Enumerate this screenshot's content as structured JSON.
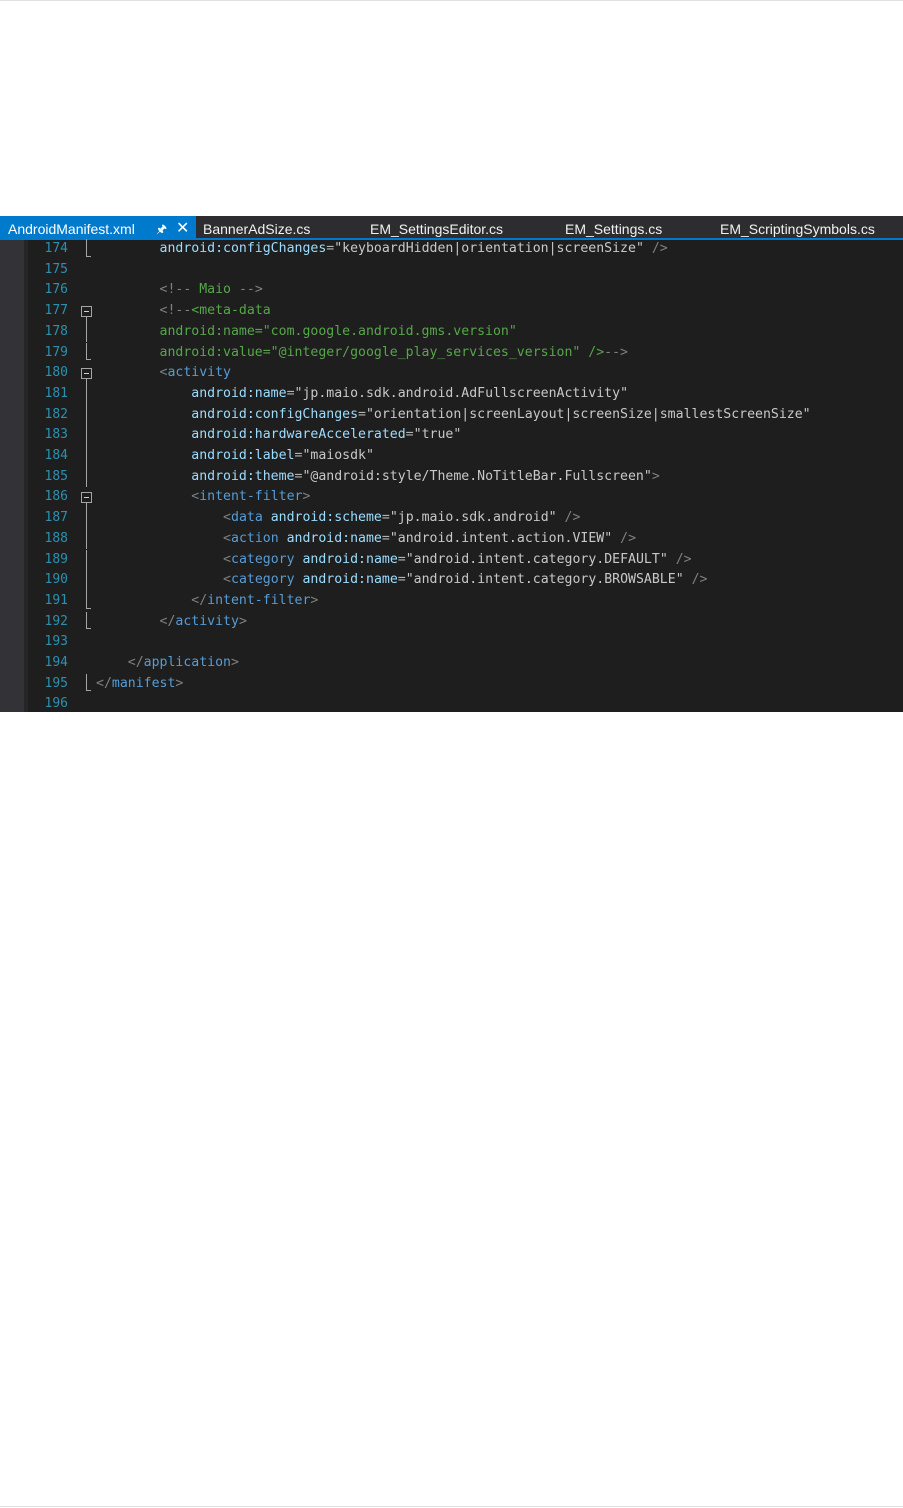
{
  "tabs": [
    {
      "label": "AndroidManifest.xml",
      "active": true,
      "pin_icon": "pin-icon",
      "close_icon": "close-icon"
    },
    {
      "label": "BannerAdSize.cs",
      "active": false
    },
    {
      "label": "EM_SettingsEditor.cs",
      "active": false
    },
    {
      "label": "EM_Settings.cs",
      "active": false
    },
    {
      "label": "EM_ScriptingSymbols.cs",
      "active": false
    }
  ],
  "colors": {
    "accent": "#007acc",
    "editor_bg": "#1e1e1e",
    "line_number": "#2b91af",
    "xml_element": "#569cd6",
    "xml_attribute": "#9cdcfe",
    "comment": "#57a64a",
    "delimiter": "#808080",
    "value": "#c8c8c8"
  },
  "code_lines": [
    {
      "n": "174",
      "fold": "end",
      "tokens": [
        [
          "t-v",
          "        "
        ],
        [
          "t-a",
          "android:configChanges"
        ],
        [
          "t-p",
          "="
        ],
        [
          "t-q",
          "\""
        ],
        [
          "t-v",
          "keyboardHidden|orientation|screenSize"
        ],
        [
          "t-q",
          "\""
        ],
        [
          "t-v",
          " "
        ],
        [
          "t-d",
          "/>"
        ]
      ]
    },
    {
      "n": "175",
      "fold": "",
      "tokens": []
    },
    {
      "n": "176",
      "fold": "",
      "tokens": [
        [
          "t-v",
          "        "
        ],
        [
          "t-d",
          "<!--"
        ],
        [
          "t-c",
          " Maio "
        ],
        [
          "t-d",
          "-->"
        ]
      ]
    },
    {
      "n": "177",
      "fold": "box",
      "tokens": [
        [
          "t-v",
          "        "
        ],
        [
          "t-d",
          "<!--"
        ],
        [
          "t-c",
          "<meta-data"
        ]
      ]
    },
    {
      "n": "178",
      "fold": "line",
      "tokens": [
        [
          "t-v",
          "        "
        ],
        [
          "t-c",
          "android:name=\"com.google.android.gms.version\""
        ]
      ]
    },
    {
      "n": "179",
      "fold": "end",
      "tokens": [
        [
          "t-v",
          "        "
        ],
        [
          "t-c",
          "android:value=\"@integer/google_play_services_version\" />"
        ],
        [
          "t-d",
          "-->"
        ]
      ]
    },
    {
      "n": "180",
      "fold": "box",
      "tokens": [
        [
          "t-v",
          "        "
        ],
        [
          "t-d",
          "<"
        ],
        [
          "t-e",
          "activity"
        ]
      ]
    },
    {
      "n": "181",
      "fold": "line",
      "tokens": [
        [
          "t-v",
          "            "
        ],
        [
          "t-a",
          "android:name"
        ],
        [
          "t-p",
          "="
        ],
        [
          "t-q",
          "\""
        ],
        [
          "t-v",
          "jp.maio.sdk.android.AdFullscreenActivity"
        ],
        [
          "t-q",
          "\""
        ]
      ]
    },
    {
      "n": "182",
      "fold": "line",
      "tokens": [
        [
          "t-v",
          "            "
        ],
        [
          "t-a",
          "android:configChanges"
        ],
        [
          "t-p",
          "="
        ],
        [
          "t-q",
          "\""
        ],
        [
          "t-v",
          "orientation|screenLayout|screenSize|smallestScreenSize"
        ],
        [
          "t-q",
          "\""
        ]
      ]
    },
    {
      "n": "183",
      "fold": "line",
      "tokens": [
        [
          "t-v",
          "            "
        ],
        [
          "t-a",
          "android:hardwareAccelerated"
        ],
        [
          "t-p",
          "="
        ],
        [
          "t-q",
          "\""
        ],
        [
          "t-v",
          "true"
        ],
        [
          "t-q",
          "\""
        ]
      ]
    },
    {
      "n": "184",
      "fold": "line",
      "tokens": [
        [
          "t-v",
          "            "
        ],
        [
          "t-a",
          "android:label"
        ],
        [
          "t-p",
          "="
        ],
        [
          "t-q",
          "\""
        ],
        [
          "t-v",
          "maiosdk"
        ],
        [
          "t-q",
          "\""
        ]
      ]
    },
    {
      "n": "185",
      "fold": "line",
      "tokens": [
        [
          "t-v",
          "            "
        ],
        [
          "t-a",
          "android:theme"
        ],
        [
          "t-p",
          "="
        ],
        [
          "t-q",
          "\""
        ],
        [
          "t-v",
          "@android:style/Theme.NoTitleBar.Fullscreen"
        ],
        [
          "t-q",
          "\""
        ],
        [
          "t-d",
          ">"
        ]
      ]
    },
    {
      "n": "186",
      "fold": "box",
      "tokens": [
        [
          "t-v",
          "            "
        ],
        [
          "t-d",
          "<"
        ],
        [
          "t-e",
          "intent-filter"
        ],
        [
          "t-d",
          ">"
        ]
      ]
    },
    {
      "n": "187",
      "fold": "line",
      "tokens": [
        [
          "t-v",
          "                "
        ],
        [
          "t-d",
          "<"
        ],
        [
          "t-e",
          "data"
        ],
        [
          "t-v",
          " "
        ],
        [
          "t-a",
          "android:scheme"
        ],
        [
          "t-p",
          "="
        ],
        [
          "t-q",
          "\""
        ],
        [
          "t-v",
          "jp.maio.sdk.android"
        ],
        [
          "t-q",
          "\""
        ],
        [
          "t-v",
          " "
        ],
        [
          "t-d",
          "/>"
        ]
      ]
    },
    {
      "n": "188",
      "fold": "line",
      "tokens": [
        [
          "t-v",
          "                "
        ],
        [
          "t-d",
          "<"
        ],
        [
          "t-e",
          "action"
        ],
        [
          "t-v",
          " "
        ],
        [
          "t-a",
          "android:name"
        ],
        [
          "t-p",
          "="
        ],
        [
          "t-q",
          "\""
        ],
        [
          "t-v",
          "android.intent.action.VIEW"
        ],
        [
          "t-q",
          "\""
        ],
        [
          "t-v",
          " "
        ],
        [
          "t-d",
          "/>"
        ]
      ]
    },
    {
      "n": "189",
      "fold": "line",
      "tokens": [
        [
          "t-v",
          "                "
        ],
        [
          "t-d",
          "<"
        ],
        [
          "t-e",
          "category"
        ],
        [
          "t-v",
          " "
        ],
        [
          "t-a",
          "android:name"
        ],
        [
          "t-p",
          "="
        ],
        [
          "t-q",
          "\""
        ],
        [
          "t-v",
          "android.intent.category.DEFAULT"
        ],
        [
          "t-q",
          "\""
        ],
        [
          "t-v",
          " "
        ],
        [
          "t-d",
          "/>"
        ]
      ]
    },
    {
      "n": "190",
      "fold": "line",
      "tokens": [
        [
          "t-v",
          "                "
        ],
        [
          "t-d",
          "<"
        ],
        [
          "t-e",
          "category"
        ],
        [
          "t-v",
          " "
        ],
        [
          "t-a",
          "android:name"
        ],
        [
          "t-p",
          "="
        ],
        [
          "t-q",
          "\""
        ],
        [
          "t-v",
          "android.intent.category.BROWSABLE"
        ],
        [
          "t-q",
          "\""
        ],
        [
          "t-v",
          " "
        ],
        [
          "t-d",
          "/>"
        ]
      ]
    },
    {
      "n": "191",
      "fold": "end",
      "tokens": [
        [
          "t-v",
          "            "
        ],
        [
          "t-d",
          "</"
        ],
        [
          "t-e",
          "intent-filter"
        ],
        [
          "t-d",
          ">"
        ]
      ]
    },
    {
      "n": "192",
      "fold": "end",
      "tokens": [
        [
          "t-v",
          "        "
        ],
        [
          "t-d",
          "</"
        ],
        [
          "t-e",
          "activity"
        ],
        [
          "t-d",
          ">"
        ]
      ]
    },
    {
      "n": "193",
      "fold": "",
      "tokens": []
    },
    {
      "n": "194",
      "fold": "",
      "tokens": [
        [
          "t-v",
          "    "
        ],
        [
          "t-d",
          "</"
        ],
        [
          "t-e",
          "application"
        ],
        [
          "t-d",
          ">"
        ]
      ]
    },
    {
      "n": "195",
      "fold": "end",
      "tokens": [
        [
          "t-d",
          "</"
        ],
        [
          "t-e",
          "manifest"
        ],
        [
          "t-d",
          ">"
        ]
      ]
    },
    {
      "n": "196",
      "fold": "",
      "tokens": []
    }
  ]
}
